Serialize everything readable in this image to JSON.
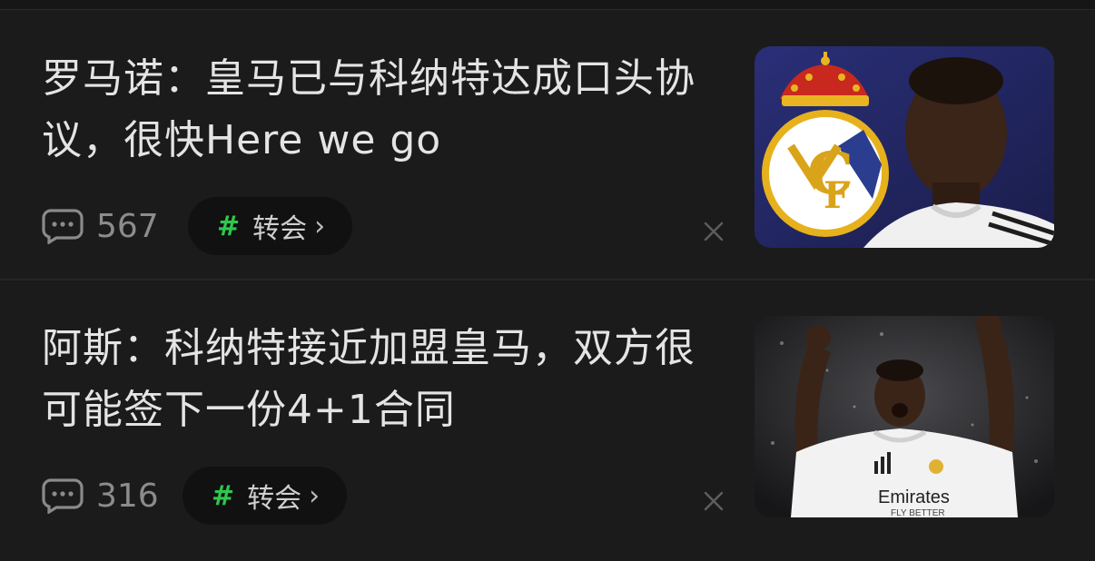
{
  "feed": {
    "items": [
      {
        "headline": "罗马诺：皇马已与科纳特达成口头协议，很快Here we go",
        "comment_count": "567",
        "tag": "转会",
        "tag_symbol": "#",
        "thumbnail_icon": "image-real-madrid-crest-player"
      },
      {
        "headline": "阿斯：科纳特接近加盟皇马，双方很可能签下一份4+1合同",
        "comment_count": "316",
        "tag": "转会",
        "tag_symbol": "#",
        "thumbnail_icon": "image-player-celebrating",
        "jersey_text": "Emirates",
        "jersey_subtext": "FLY BETTER"
      }
    ]
  },
  "colors": {
    "background": "#1b1b1b",
    "headline": "#e4e4e4",
    "tag_hash": "#2ec84c",
    "muted": "#8c8c8c"
  }
}
